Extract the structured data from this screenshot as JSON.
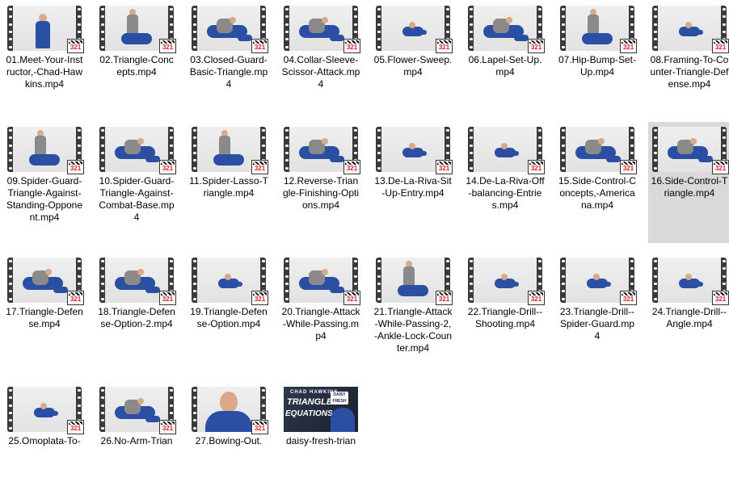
{
  "items": [
    {
      "label": "01.Meet-Your-Instructor,-Chad-Hawkins.mp4",
      "badge": "321",
      "scene": "standing"
    },
    {
      "label": "02.Triangle-Concepts.mp4",
      "badge": "321",
      "scene": "pair-standing"
    },
    {
      "label": "03.Closed-Guard-Basic-Triangle.mp4",
      "badge": "321",
      "scene": "pair-ground"
    },
    {
      "label": "04.Collar-Sleeve-Scissor-Attack.mp4",
      "badge": "321",
      "scene": "pair-ground"
    },
    {
      "label": "05.Flower-Sweep.mp4",
      "badge": "321",
      "scene": "small-ground"
    },
    {
      "label": "06.Lapel-Set-Up.mp4",
      "badge": "321",
      "scene": "pair-ground"
    },
    {
      "label": "07.Hip-Bump-Set-Up.mp4",
      "badge": "321",
      "scene": "pair-standing"
    },
    {
      "label": "08.Framing-To-Counter-Triangle-Defense.mp4",
      "badge": "321",
      "scene": "small-ground"
    },
    {
      "label": "09.Spider-Guard-Triangle-Against-Standing-Opponent.mp4",
      "badge": "321",
      "scene": "pair-standing"
    },
    {
      "label": "10.Spider-Guard-Triangle-Against-Combat-Base.mp4",
      "badge": "321",
      "scene": "pair-ground"
    },
    {
      "label": "11.Spider-Lasso-Triangle.mp4",
      "badge": "321",
      "scene": "pair-standing"
    },
    {
      "label": "12.Reverse-Triangle-Finishing-Options.mp4",
      "badge": "321",
      "scene": "pair-ground"
    },
    {
      "label": "13.De-La-Riva-Sit-Up-Entry.mp4",
      "badge": "321",
      "scene": "small-ground"
    },
    {
      "label": "14.De-La-Riva-Off-balancing-Entries.mp4",
      "badge": "321",
      "scene": "small-ground"
    },
    {
      "label": "15.Side-Control-Concepts,-Americana.mp4",
      "badge": "321",
      "scene": "pair-ground"
    },
    {
      "label": "16.Side-Control-Triangle.mp4",
      "badge": "321",
      "scene": "pair-ground",
      "selected": true
    },
    {
      "label": "17.Triangle-Defense.mp4",
      "badge": "321",
      "scene": "pair-ground"
    },
    {
      "label": "18.Triangle-Defense-Option-2.mp4",
      "badge": "321",
      "scene": "pair-ground"
    },
    {
      "label": "19.Triangle-Defense-Option.mp4",
      "badge": "321",
      "scene": "small-ground"
    },
    {
      "label": "20.Triangle-Attack-While-Passing.mp4",
      "badge": "321",
      "scene": "pair-ground"
    },
    {
      "label": "21.Triangle-Attack-While-Passing-2,-Ankle-Lock-Counter.mp4",
      "badge": "321",
      "scene": "pair-standing"
    },
    {
      "label": "22.Triangle-Drill--Shooting.mp4",
      "badge": "321",
      "scene": "small-ground"
    },
    {
      "label": "23.Triangle-Drill--Spider-Guard.mp4",
      "badge": "321",
      "scene": "small-ground"
    },
    {
      "label": "24.Triangle-Drill--Angle.mp4",
      "badge": "321",
      "scene": "small-ground"
    },
    {
      "label": "25.Omoplata-To-",
      "badge": "321",
      "scene": "small-ground"
    },
    {
      "label": "26.No-Arm-Trian",
      "badge": "321",
      "scene": "pair-ground"
    },
    {
      "label": "27.Bowing-Out.",
      "badge": "321",
      "scene": "closeup"
    },
    {
      "label": "daisy-fresh-trian",
      "scene": "poster",
      "poster": {
        "line1": "CHAD HAWKINS",
        "line2": "TRIANGLE",
        "line3": "EQUATIONS",
        "logo": "DAISY FRESH"
      }
    }
  ],
  "colors": {
    "gi_blue": "#2a4fa3",
    "gi_gray": "#8a8a8a",
    "skin": "#d9a98a",
    "selection": "#d9d9d9"
  }
}
